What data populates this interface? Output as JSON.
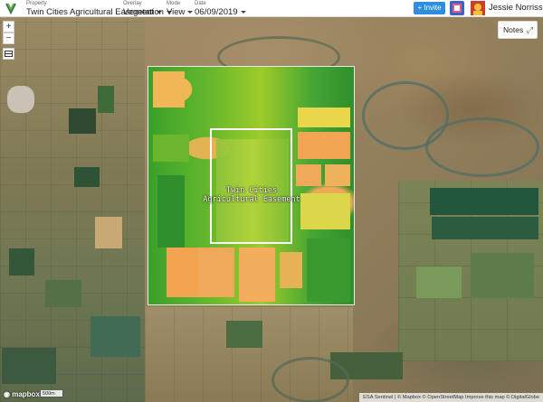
{
  "topbar": {
    "property": {
      "caption": "Property",
      "value": "Twin Cities Agricultural Easement"
    },
    "overlay": {
      "caption": "Overlay",
      "value": "Vegetation"
    },
    "mode": {
      "caption": "Mode",
      "value": "View"
    },
    "date": {
      "caption": "Date",
      "value": "06/09/2019"
    },
    "invite_label": "Invite",
    "user_name": "Jessie Norriss"
  },
  "map": {
    "zoom_in": "+",
    "zoom_out": "−",
    "property_label": "Twin Cities Agricultural Easement",
    "notes_label": "Notes",
    "logo_text": "mapbox",
    "scale_text": "500m",
    "attribution": "ESA Sentinel | © Mapbox © OpenStreetMap Improve this map © DigitalGlobe"
  },
  "colors": {
    "invite_button": "#2d8de0",
    "vegetation_high": "#2f8f2c",
    "vegetation_low": "#f1a857"
  }
}
